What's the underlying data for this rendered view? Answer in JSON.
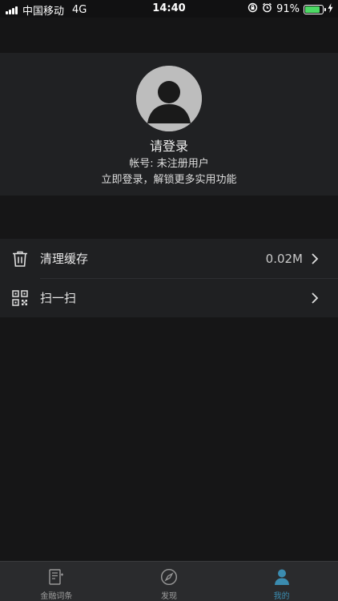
{
  "status_bar": {
    "carrier": "中国移动",
    "network": "4G",
    "time": "14:40",
    "battery": "91%",
    "battery_level": 0.91
  },
  "profile": {
    "login_title": "请登录",
    "account_text": "帐号: 未注册用户",
    "hint_text": "立即登录，解锁更多实用功能"
  },
  "menu": {
    "items": [
      {
        "label": "清理缓存",
        "value": "0.02M",
        "icon": "trash-icon"
      },
      {
        "label": "扫一扫",
        "value": "",
        "icon": "qr-scan-icon"
      }
    ]
  },
  "tab_bar": {
    "tabs": [
      {
        "label": "金融词条",
        "icon": "dictionary-icon",
        "active": false
      },
      {
        "label": "发现",
        "icon": "compass-icon",
        "active": false
      },
      {
        "label": "我的",
        "icon": "person-icon",
        "active": true
      }
    ],
    "active_color": "#3b8cb0",
    "inactive_color": "#a0a0a0"
  }
}
